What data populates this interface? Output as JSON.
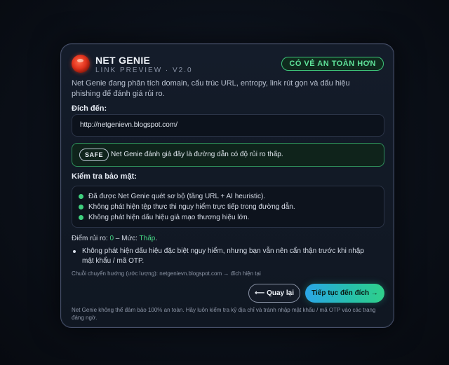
{
  "header": {
    "brand": "NET GENIE",
    "subtitle": "LINK PREVIEW · V2.0",
    "status_badge": "CÓ VẺ AN TOÀN HƠN"
  },
  "description": "Net Genie đang phân tích domain, cấu trúc URL, entropy, link rút gọn và dấu hiệu phishing để đánh giá rủi ro.",
  "destination": {
    "label": "Đích đến:",
    "url": "http://netgenievn.blogspot.com/"
  },
  "safety": {
    "pill": "SAFE",
    "message": "Net Genie đánh giá đây là đường dẫn có độ rủi ro thấp."
  },
  "security_check": {
    "label": "Kiểm tra bảo mật:",
    "items": [
      "Đã được Net Genie quét sơ bộ (tầng URL + AI heuristic).",
      "Không phát hiện tệp thực thi nguy hiểm trực tiếp trong đường dẫn.",
      "Không phát hiện dấu hiệu giả mạo thương hiệu lớn."
    ]
  },
  "risk": {
    "prefix": "Điểm rủi ro: ",
    "score": "0",
    "separator": " – Mức: ",
    "level": "Thấp",
    "suffix": ".",
    "note": "Không phát hiện dấu hiệu đặc biệt nguy hiểm, nhưng bạn vẫn nên cẩn thận trước khi nhập mật khẩu / mã OTP."
  },
  "redirect_chain": "Chuỗi chuyển hướng (ước lượng): netgenievn.blogspot.com → đích hiện tại",
  "buttons": {
    "back": "⟵ Quay lại",
    "continue": "Tiếp tục đến đích →"
  },
  "footer": "Net Genie không thể đảm bảo 100% an toàn. Hãy luôn kiểm tra kỹ địa chỉ và tránh nhập mật khẩu / mã OTP vào các trang đáng ngờ.",
  "colors": {
    "accent_green": "#46d685",
    "safe_border": "#2e8f5a",
    "button_gradient_start": "#2aa6e8",
    "button_gradient_end": "#2fd08a"
  }
}
